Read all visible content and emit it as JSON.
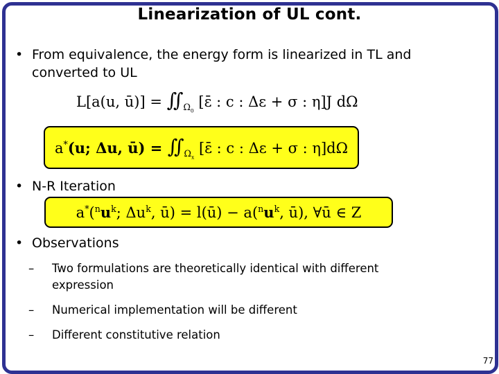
{
  "slide": {
    "title": "Linearization of UL cont.",
    "page_number": "77",
    "border_color": "#2e3192",
    "highlight_color": "#ffff1a",
    "bullets": [
      {
        "marker": "•",
        "text_line1": "From equivalence, the energy form is linearized in TL and",
        "text_line2": "converted to UL"
      },
      {
        "marker": "•",
        "text": "N-R Iteration"
      },
      {
        "marker": "•",
        "text": "Observations",
        "sub_items": [
          {
            "marker": "–",
            "text_line1": "Two formulations are theoretically identical with different",
            "text_line2": "expression"
          },
          {
            "marker": "–",
            "text": "Numerical implementation will be different"
          },
          {
            "marker": "–",
            "text": "Different constitutive relation"
          }
        ]
      }
    ],
    "equations": {
      "tl_linearization": {
        "lhs": "L[a(u, ū)] = ",
        "integral": "∬",
        "domain": "Ω",
        "domain_sub": "0",
        "integrand": "[ε̄ : c : Δε + σ : η]J dΩ"
      },
      "ul_linearization": {
        "lhs": "a",
        "star": "*",
        "args": "(u; Δu, ū) = ",
        "integral": "∬",
        "domain": "Ω",
        "domain_sub": "x",
        "integrand": "[ε̄ : c : Δε + σ : η]dΩ"
      },
      "nr_iteration": {
        "text_a": "a",
        "star": "*",
        "part1": "(",
        "pre_n": "n",
        "u1": "u",
        "sup_k1": "k",
        "part2": "; Δu",
        "sup_k2": "k",
        "part3": ", ū) = l(ū) − a(",
        "pre_n2": "n",
        "u2": "u",
        "sup_k3": "k",
        "part4": ", ū),    ∀ū ∈ Z"
      }
    }
  }
}
